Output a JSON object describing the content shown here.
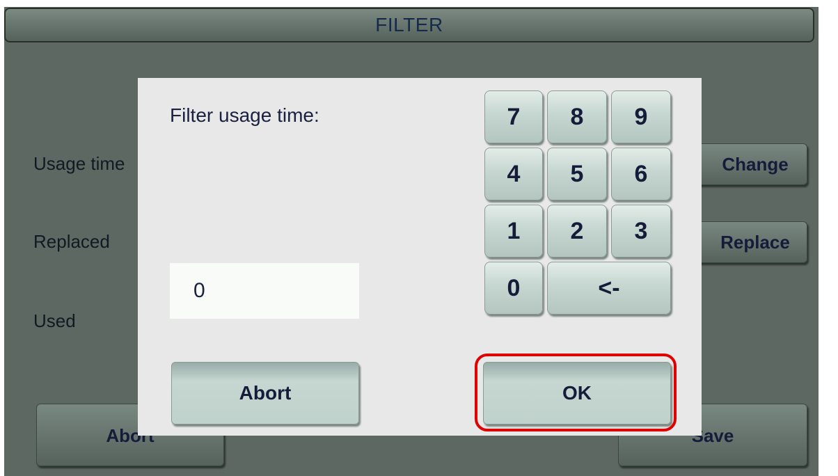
{
  "header": {
    "title": "FILTER"
  },
  "background": {
    "labels": {
      "usage_time": "Usage time",
      "replaced": "Replaced",
      "used": "Used"
    },
    "buttons": {
      "change": "Change",
      "replace": "Replace",
      "abort": "Abort",
      "save": "Save"
    }
  },
  "dialog": {
    "label": "Filter usage time:",
    "value": "0",
    "keypad": {
      "k7": "7",
      "k8": "8",
      "k9": "9",
      "k4": "4",
      "k5": "5",
      "k6": "6",
      "k1": "1",
      "k2": "2",
      "k3": "3",
      "k0": "0",
      "backspace": "<-"
    },
    "abort_label": "Abort",
    "ok_label": "OK"
  },
  "colors": {
    "screen_bg": "#5e6862",
    "dialog_bg": "#e8e8e8",
    "key_face": "#c6d6d0",
    "text_dark": "#141c3a",
    "highlight": "#e00000"
  }
}
